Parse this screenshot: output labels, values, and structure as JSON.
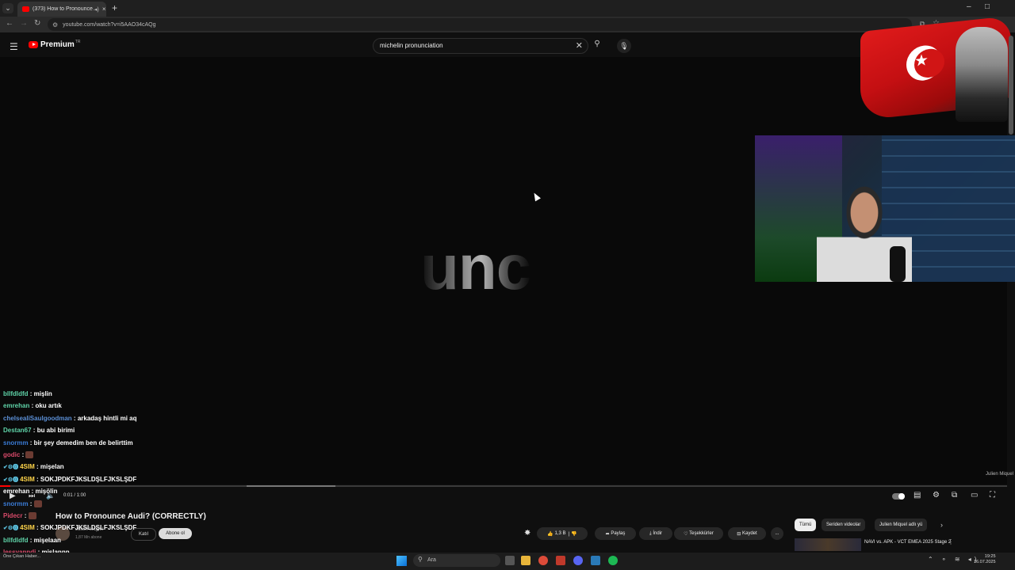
{
  "browser": {
    "tab_title": "(373) How to Pronounce Au",
    "url": "youtube.com/watch?v=i5AAO34cAQg",
    "new_tab_icon": "+",
    "close_icon": "×"
  },
  "youtube": {
    "logo_text": "Premium",
    "logo_region": "TR",
    "search_query": "michelin pronunciation"
  },
  "video": {
    "frame_text": "unc",
    "watermark": "Julien Miquel",
    "progress": 0.01,
    "buffered_start": 0.245,
    "buffered_end": 0.333,
    "time": "0:01 / 1:00",
    "title": "How to Pronounce Audi? (CORRECTLY)",
    "channel": "Julien Miquel",
    "subscribers": "1,87 Mn abone",
    "join_label": "Katıl",
    "subscribe_label": "Abone ol",
    "like_count": "1,3 B",
    "share_label": "Paylaş",
    "download_label": "İndir",
    "thanks_label": "Teşekkürler",
    "save_label": "Kaydet",
    "more_label": "..."
  },
  "sidebar": {
    "chips": [
      "Tümü",
      "Seriden videolar",
      "Julien Miquel adlı yü"
    ],
    "rec_title": "NAVI vs. APK - VCT EMEA 2025 Stage 2"
  },
  "chat": [
    {
      "user": "bllfdldfd",
      "color": "#5fd3a8",
      "msg": "mişlin"
    },
    {
      "user": "emrehan",
      "color": "#5fd3a8",
      "msg": "oku artık"
    },
    {
      "user": "chelsealiSaulgoodman",
      "color": "#5b8fd6",
      "msg": "arkadaş hintli mi aq"
    },
    {
      "user": "Destan67",
      "color": "#5fd3a8",
      "msg": "bu abi birimi"
    },
    {
      "user": "snormm",
      "color": "#3a7bd5",
      "msg": "bir şey demedim ben de belirttim"
    },
    {
      "user": "godic",
      "color": "#d94a6a",
      "msg": "",
      "emote": true
    },
    {
      "user": "4SIM",
      "color": "#ffd54a",
      "msg": "mişelan",
      "badges": true
    },
    {
      "user": "4SIM",
      "color": "#ffd54a",
      "msg": "SOKJPDKFJKSLDŞLFJKSLŞDF",
      "badges": true
    },
    {
      "user": "emrehan",
      "color": "#ffffff",
      "msg": "mişölin"
    },
    {
      "user": "snormm",
      "color": "#3a7bd5",
      "msg": "",
      "emote": true
    },
    {
      "user": "Pidecr",
      "color": "#d94a6a",
      "msg": "",
      "emote": true
    },
    {
      "user": "4SIM",
      "color": "#ffd54a",
      "msg": "SOKJPDKFJKSLDŞLFJKSLŞDF",
      "badges": true
    },
    {
      "user": "bllfdldfd",
      "color": "#5fd3a8",
      "msg": "mişelaan"
    },
    {
      "user": "lessvanndi",
      "color": "#d94a6a",
      "msg": "mişlannn"
    }
  ],
  "taskbar": {
    "search_label": "Ara",
    "time": "19:25",
    "date": "16.07.2025",
    "widget": "Öne Çıkan Haber..."
  },
  "colors": {
    "accent": "#ff0000",
    "bg": "#0f0f0f"
  }
}
